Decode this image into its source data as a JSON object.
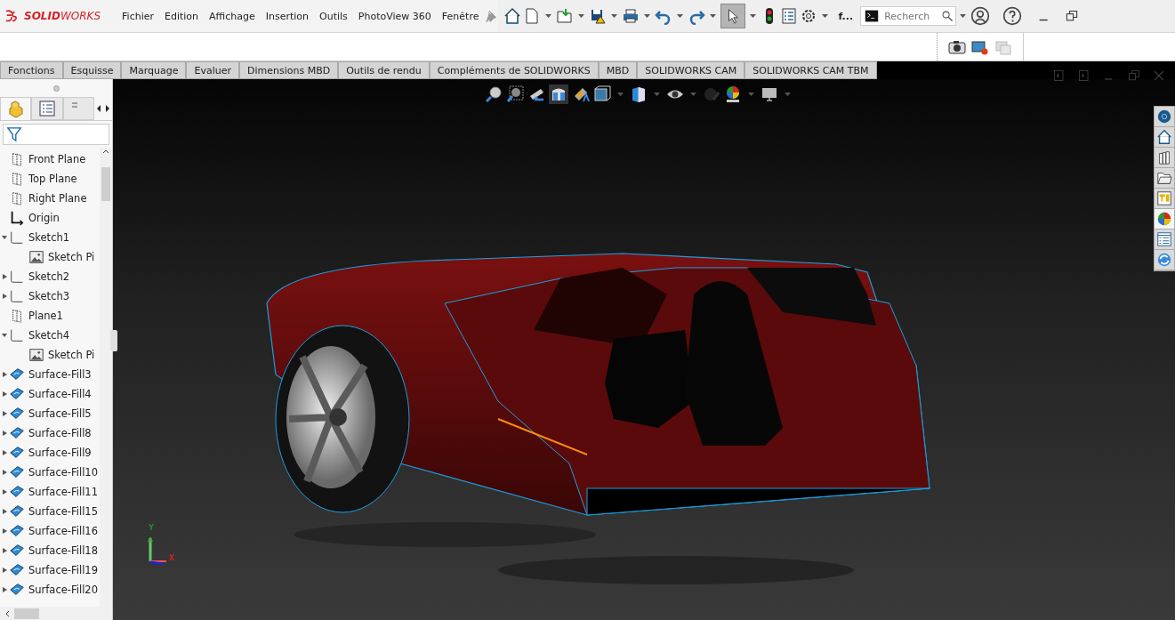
{
  "app": {
    "logo_bold": "SOLID",
    "logo_light": "WORKS"
  },
  "menu": [
    "Fichier",
    "Edition",
    "Affichage",
    "Insertion",
    "Outils",
    "PhotoView 360",
    "Fenêtre"
  ],
  "toolbar": {
    "select_pressed": true,
    "more_label": "f...",
    "search_placeholder": "Recherch"
  },
  "command_tabs": [
    {
      "label": "Fonctions",
      "selected": false
    },
    {
      "label": "Esquisse",
      "selected": false
    },
    {
      "label": "Marquage",
      "selected": false
    },
    {
      "label": "Evaluer",
      "selected": false
    },
    {
      "label": "Dimensions MBD",
      "selected": false
    },
    {
      "label": "Outils de rendu",
      "selected": false
    },
    {
      "label": "Compléments de SOLIDWORKS",
      "selected": false
    },
    {
      "label": "MBD",
      "selected": false
    },
    {
      "label": "SOLIDWORKS CAM",
      "selected": false
    },
    {
      "label": "SOLIDWORKS CAM TBM",
      "selected": false
    }
  ],
  "panel_tabs": [
    {
      "kind": "feature",
      "selected": true
    },
    {
      "kind": "property",
      "selected": false
    },
    {
      "kind": "config",
      "selected": false
    }
  ],
  "tree": [
    {
      "kind": "plane",
      "label": "Front Plane"
    },
    {
      "kind": "plane",
      "label": "Top Plane"
    },
    {
      "kind": "plane",
      "label": "Right Plane"
    },
    {
      "kind": "origin",
      "label": "Origin"
    },
    {
      "kind": "sketch",
      "label": "Sketch1",
      "expanded": true,
      "children": [
        {
          "kind": "picture",
          "label": "Sketch Pi"
        }
      ]
    },
    {
      "kind": "sketch",
      "label": "Sketch2",
      "expanded": false
    },
    {
      "kind": "sketch",
      "label": "Sketch3",
      "expanded": false
    },
    {
      "kind": "plane",
      "label": "Plane1"
    },
    {
      "kind": "sketch",
      "label": "Sketch4",
      "expanded": true,
      "children": [
        {
          "kind": "picture",
          "label": "Sketch Pi"
        }
      ]
    },
    {
      "kind": "surface",
      "label": "Surface-Fill3",
      "expanded": false
    },
    {
      "kind": "surface",
      "label": "Surface-Fill4",
      "expanded": false
    },
    {
      "kind": "surface",
      "label": "Surface-Fill5",
      "expanded": false
    },
    {
      "kind": "surface",
      "label": "Surface-Fill8",
      "expanded": false
    },
    {
      "kind": "surface",
      "label": "Surface-Fill9",
      "expanded": false
    },
    {
      "kind": "surface",
      "label": "Surface-Fill10",
      "expanded": false
    },
    {
      "kind": "surface",
      "label": "Surface-Fill11",
      "expanded": false
    },
    {
      "kind": "surface",
      "label": "Surface-Fill15",
      "expanded": false
    },
    {
      "kind": "surface",
      "label": "Surface-Fill16",
      "expanded": false
    },
    {
      "kind": "surface",
      "label": "Surface-Fill18",
      "expanded": false
    },
    {
      "kind": "surface",
      "label": "Surface-Fill19",
      "expanded": false
    },
    {
      "kind": "surface",
      "label": "Surface-Fill20",
      "expanded": false
    }
  ],
  "task_pane": [
    {
      "kind": "resources",
      "selected": false
    },
    {
      "kind": "home",
      "selected": false
    },
    {
      "kind": "library",
      "selected": false
    },
    {
      "kind": "explorer",
      "selected": false
    },
    {
      "kind": "palette",
      "selected": false
    },
    {
      "kind": "appearances",
      "selected": true
    },
    {
      "kind": "properties",
      "selected": false
    },
    {
      "kind": "update",
      "selected": false
    }
  ],
  "triad": {
    "y_label": "Y",
    "x_label": "X"
  }
}
